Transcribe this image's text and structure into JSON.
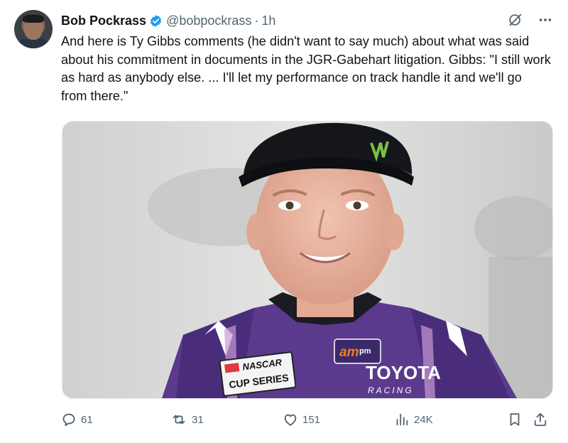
{
  "author": {
    "name": "Bob Pockrass",
    "handle": "@bobpockrass",
    "separator": "·",
    "time": "1h"
  },
  "tweet": {
    "text": "And here is Ty Gibbs comments (he didn't want to say much) about what was said about his commitment in documents in the JGR-Gabehart litigation. Gibbs: \"I still work as hard as anybody else. ... I'll let my performance on track handle it and we'll go from there.\""
  },
  "media": {
    "logo_brand": "am",
    "logo_suffix": "pm",
    "patch_line1": "NASCAR",
    "patch_line2": "CUP SERIES",
    "sponsor": "TOYOTA",
    "sponsor_sub": "RACING"
  },
  "actions": {
    "replies": "61",
    "reposts": "31",
    "likes": "151",
    "views": "24K"
  },
  "colors": {
    "verified": "#1d9bf0",
    "text_secondary": "#536471",
    "suit": "#5b3a8e"
  },
  "icons": [
    "verified-badge-icon",
    "grok-icon",
    "more-icon",
    "reply-icon",
    "repost-icon",
    "like-icon",
    "views-icon",
    "bookmark-icon",
    "share-icon"
  ]
}
